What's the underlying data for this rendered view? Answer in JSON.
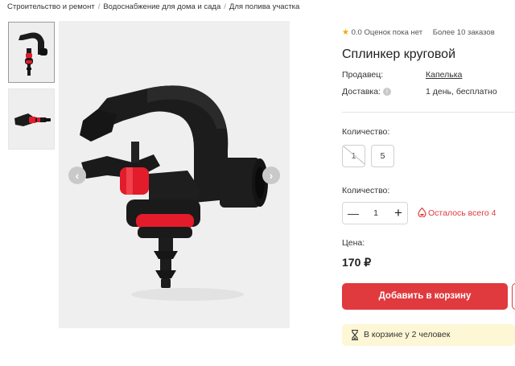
{
  "breadcrumb": {
    "items": [
      "Строительство и ремонт",
      "Водоснабжение для дома и сада",
      "Для полива участка"
    ]
  },
  "gallery": {
    "thumbnails": [
      "sprinkler-front",
      "sprinkler-side"
    ],
    "active_index": 0,
    "main_image": "sprinkler-front"
  },
  "product": {
    "rating_value": "0.0",
    "rating_text": "Оценок пока нет",
    "orders_text": "Более 10 заказов",
    "title": "Сплинкер круговой",
    "seller_label": "Продавец:",
    "seller_value": "Капелька",
    "delivery_label": "Доставка:",
    "delivery_value": "1 день, бесплатно"
  },
  "quantity_options": {
    "label": "Количество:",
    "options": [
      {
        "value": "1",
        "available": false
      },
      {
        "value": "5",
        "available": true
      }
    ]
  },
  "quantity_stepper": {
    "label": "Количество:",
    "minus": "—",
    "value": "1",
    "plus": "+",
    "stock_text": "Осталось всего 4"
  },
  "price": {
    "label": "Цена:",
    "value": "170 ₽"
  },
  "actions": {
    "add_to_cart": "Добавить в корзину",
    "in_cart_text": "В корзине у 2 человек"
  },
  "colors": {
    "accent_red": "#e0393e",
    "star": "#f2a900",
    "banner_bg": "#fdf7d6"
  }
}
